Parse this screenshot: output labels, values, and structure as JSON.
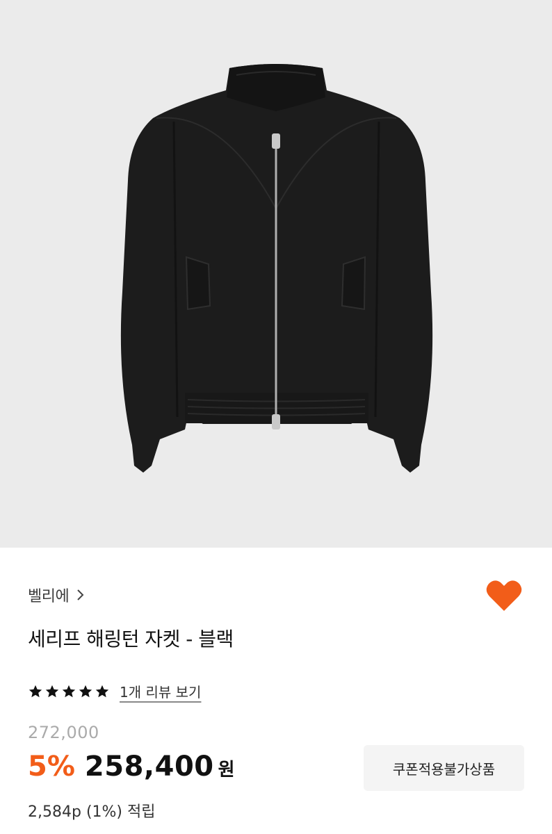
{
  "product": {
    "image_alt": "black harrington jacket",
    "brand": "벨리에",
    "title": "세리프 해링턴 자켓 - 블랙",
    "rating": 5,
    "review_link": "1개 리뷰 보기",
    "original_price": "272,000",
    "discount": "5%",
    "price": "258,400",
    "currency": "원",
    "points": "2,584p (1%) 적립",
    "coupon_label": "쿠폰적용불가상품",
    "wishlisted": true
  },
  "colors": {
    "accent": "#f25d19",
    "background_image": "#ebebeb",
    "jacket": "#1c1c1c"
  },
  "icons": {
    "brand_arrow": "chevron-right-icon",
    "wishlist": "heart-icon",
    "rating": "star-icon"
  }
}
